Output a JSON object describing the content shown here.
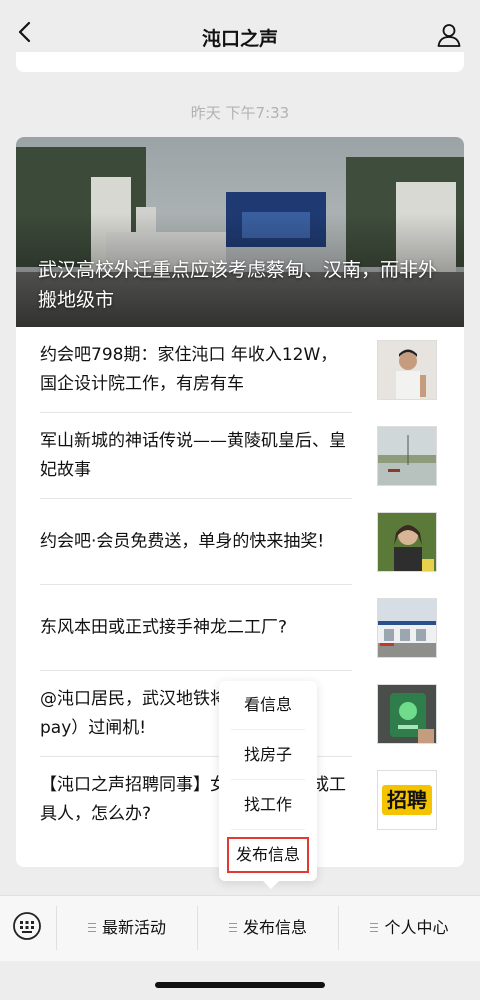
{
  "nav": {
    "title": "沌口之声",
    "back_icon": "chevron-left-icon",
    "profile_icon": "person-icon"
  },
  "message": {
    "timestamp": "昨天 下午7:33",
    "cover": {
      "title": "武汉高校外迁重点应该考虑蔡甸、汉南，而非外搬地级市"
    },
    "items": [
      {
        "title": "约会吧798期：家住沌口 年收入12W，国企设计院工作，有房有车"
      },
      {
        "title": "军山新城的神话传说——黄陵矶皇后、皇妃故事"
      },
      {
        "title": "约会吧·会员免费送，单身的快来抽奖!"
      },
      {
        "title": "东风本田或正式接手神龙二工厂?"
      },
      {
        "title": "@沌口居民，武汉地铁将可刷（手机pay）过闸机!"
      },
      {
        "title": "【沌口之声招聘同事】女同事长期当成工具人，怎么办?"
      }
    ],
    "recruit_thumb_text": "招聘"
  },
  "popup_menu": {
    "items": [
      {
        "label": "看信息"
      },
      {
        "label": "找房子"
      },
      {
        "label": "找工作"
      },
      {
        "label": "发布信息"
      }
    ],
    "selected": "发布信息"
  },
  "bottom_bar": {
    "keyboard_icon": "keyboard-icon",
    "tabs": [
      {
        "label": "最新活动"
      },
      {
        "label": "发布信息"
      },
      {
        "label": "个人中心"
      }
    ]
  },
  "colors": {
    "highlight_border": "#e23a33",
    "background": "#ededed",
    "card": "#ffffff"
  }
}
